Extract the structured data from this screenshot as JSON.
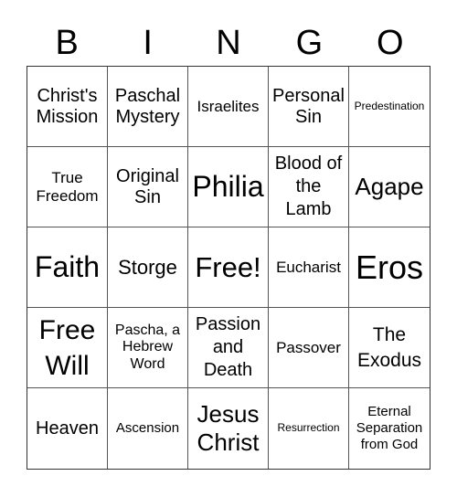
{
  "header": {
    "letters": [
      "B",
      "I",
      "N",
      "G",
      "O"
    ]
  },
  "grid": {
    "rows": [
      [
        {
          "text": "Christ's Mission"
        },
        {
          "text": "Paschal Mystery"
        },
        {
          "text": "Israelites"
        },
        {
          "text": "Personal Sin"
        },
        {
          "text": "Predestination"
        }
      ],
      [
        {
          "text": "True Freedom"
        },
        {
          "text": "Original Sin"
        },
        {
          "text": "Philia"
        },
        {
          "text": "Blood of the Lamb"
        },
        {
          "text": "Agape"
        }
      ],
      [
        {
          "text": "Faith"
        },
        {
          "text": "Storge"
        },
        {
          "text": "Free!"
        },
        {
          "text": "Eucharist"
        },
        {
          "text": "Eros"
        }
      ],
      [
        {
          "text": "Free Will"
        },
        {
          "text": "Pascha, a Hebrew Word"
        },
        {
          "text": "Passion and Death"
        },
        {
          "text": "Passover"
        },
        {
          "text": "The Exodus"
        }
      ],
      [
        {
          "text": "Heaven"
        },
        {
          "text": "Ascension"
        },
        {
          "text": "Jesus Christ"
        },
        {
          "text": "Resurrection"
        },
        {
          "text": "Eternal Separation from God"
        }
      ]
    ]
  }
}
